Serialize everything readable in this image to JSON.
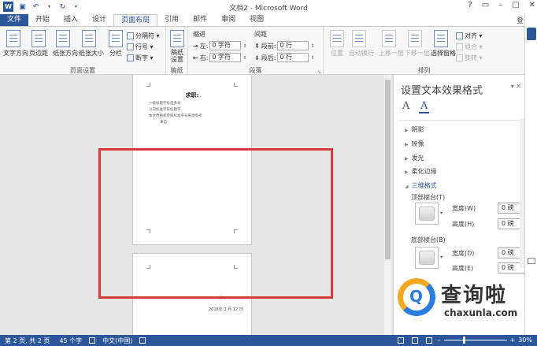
{
  "window": {
    "title": "文档2 - Microsoft Word",
    "login": "登录",
    "controls": [
      "?",
      "▭",
      "–",
      "□",
      "✕"
    ]
  },
  "quick_access": {
    "app_icon": "W",
    "icons": [
      "save-icon",
      "undo-icon",
      "redo-icon",
      "customize-icon"
    ]
  },
  "tabs": [
    {
      "label": "文件",
      "kind": "file"
    },
    {
      "label": "开始"
    },
    {
      "label": "插入"
    },
    {
      "label": "设计"
    },
    {
      "label": "页面布局",
      "active": true
    },
    {
      "label": "引用"
    },
    {
      "label": "邮件"
    },
    {
      "label": "审阅"
    },
    {
      "label": "视图"
    }
  ],
  "ribbon": {
    "page_setup": {
      "label": "页面设置",
      "buttons": [
        "文字方向",
        "页边距",
        "纸张方向",
        "纸张大小",
        "分栏"
      ],
      "small": [
        "分隔符 ▾",
        "行号 ▾",
        "断字 ▾"
      ]
    },
    "manuscript": {
      "label": "稿纸",
      "button": "稿纸\n设置"
    },
    "paragraph": {
      "label": "段落",
      "indent_title": "缩进",
      "spacing_title": "间距",
      "left_label": "左:",
      "left_value": "0 字符",
      "right_label": "右:",
      "right_value": "0 字符",
      "before_label": "段前:",
      "before_value": "0 行",
      "after_label": "段后:",
      "after_value": "0 行"
    },
    "arrange": {
      "label": "排列",
      "buttons": [
        "位置",
        "自动换行",
        "上移一层",
        "下移一层",
        "选择窗格"
      ],
      "small": [
        "对齐 ▾",
        "组合 ▾",
        "旋转 ▾"
      ]
    }
  },
  "document": {
    "page1_title": "求职:",
    "page1_lines": [
      "一级标题字号是多号",
      "公司标准字符标题字",
      "本文档格式参照标准字号来源参考",
      "来自"
    ],
    "page2_footer_small": "签名",
    "page2_date": "2018年 2 月 12 日"
  },
  "pane": {
    "title": "设置文本效果格式",
    "pin": "▾ ✕",
    "tabs": [
      "A",
      "A"
    ],
    "sections": [
      "阴影",
      "映像",
      "发光",
      "柔化边缘",
      "三维格式"
    ],
    "top_bevel": "顶部棱台(T)",
    "bottom_bevel": "底部棱台(B)",
    "width_label": "宽度(W)",
    "height_label": "高度(H)",
    "width2_label": "宽度(D)",
    "height2_label": "高度(E)",
    "value": "0 磅"
  },
  "status": {
    "page": "第 2 页, 共 2 页",
    "words": "45 个字",
    "lang": "中文(中国)",
    "zoom": "30%",
    "zoom_fraction": 0.3
  },
  "watermark": {
    "cn": "查询啦",
    "en": "chaxunla.com"
  }
}
